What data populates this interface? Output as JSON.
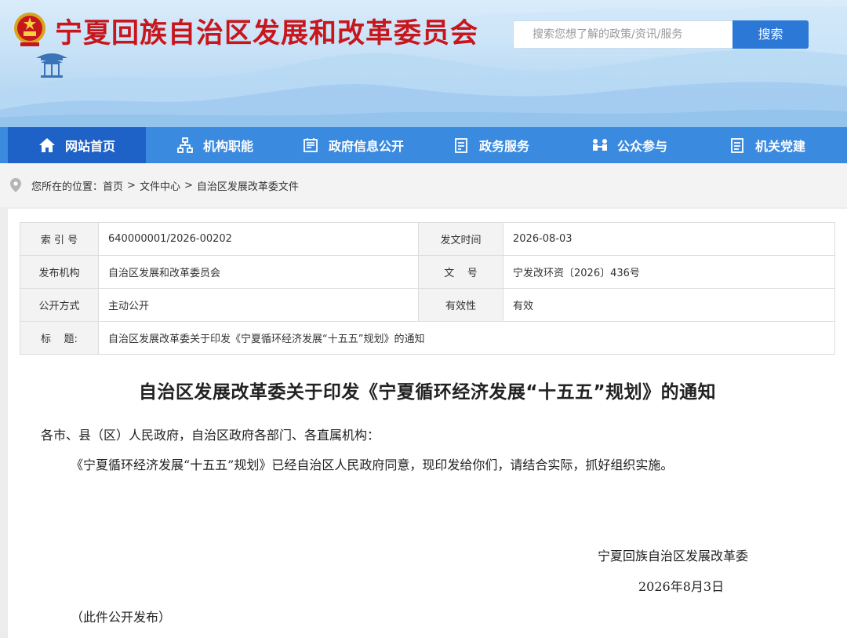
{
  "header": {
    "site_title": "宁夏回族自治区发展和改革委员会",
    "search_placeholder": "搜索您想了解的政策/资讯/服务",
    "search_button": "搜索",
    "colors": {
      "title": "#c8161d",
      "nav": "#3a8ae0",
      "nav_active": "#1f62c7",
      "search_button": "#2b78d6"
    }
  },
  "nav": {
    "items": [
      {
        "label": "网站首页",
        "icon": "home-icon"
      },
      {
        "label": "机构职能",
        "icon": "org-chart-icon"
      },
      {
        "label": "政府信息公开",
        "icon": "newspaper-icon"
      },
      {
        "label": "政务服务",
        "icon": "document-list-icon"
      },
      {
        "label": "公众参与",
        "icon": "people-icon"
      },
      {
        "label": "机关党建",
        "icon": "clipboard-icon"
      }
    ]
  },
  "breadcrumb": {
    "prefix": "您所在的位置：",
    "items": [
      "首页",
      "文件中心",
      "自治区发展改革委文件"
    ],
    "separator": ">"
  },
  "meta": {
    "index_label": "索 引 号",
    "index_value": "640000001/2026-00202",
    "date_label": "发文时间",
    "date_value": "2026-08-03",
    "issuer_label": "发布机构",
    "issuer_value": "自治区发展和改革委员会",
    "docno_label": "文    号",
    "docno_value": "宁发改环资〔2026〕436号",
    "disclosure_label": "公开方式",
    "disclosure_value": "主动公开",
    "validity_label": "有效性",
    "validity_value": "有效",
    "title_label": "标    题:",
    "title_value": "自治区发展改革委关于印发《宁夏循环经济发展“十五五”规划》的通知"
  },
  "document": {
    "title": "自治区发展改革委关于印发《宁夏循环经济发展“十五五”规划》的通知",
    "salutation": "各市、县（区）人民政府，自治区政府各部门、各直属机构：",
    "body": "《宁夏循环经济发展“十五五”规划》已经自治区人民政府同意，现印发给你们，请结合实际，抓好组织实施。",
    "signature": "宁夏回族自治区发展改革委",
    "date": "2026年8月3日",
    "note": "（此件公开发布）"
  }
}
